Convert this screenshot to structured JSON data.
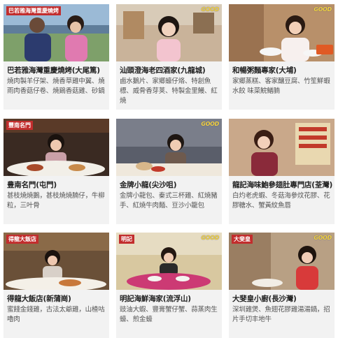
{
  "badge": {
    "brand": "GOOD"
  },
  "cards": [
    {
      "title": "巴若雅海灣重慶燒烤(大尾篤)",
      "desc": "燒肉製羊仔架、燒香草雞中翼、燒雨肉香菇仔卷、燒鷄香菇雞、砂鍋",
      "logo": "巴若雅海灣重慶燒烤"
    },
    {
      "title": "汕頭澄海老四酒家(九龍城)",
      "desc": "鹵水鵝片、家鄉蠔仔烙、特創魚標、威骨香芽荚、特製金里鰻、紅燒",
      "logo": ""
    },
    {
      "title": "和暢粥麵專家(大埔)",
      "desc": "家鄉蒸糕、客家釀豆腐、竹笙鮮蝦水餃 味菜鯇鱔腩",
      "logo": ""
    },
    {
      "title": "豊南名門(屯門)",
      "desc": "甚枝燒燒鵝，甚枝燒燒腩仔，牛柳粒，三叶骨",
      "logo": "豐南名門"
    },
    {
      "title": "金牌小龍(尖沙咀)",
      "desc": "金牌小龍包、秦式三杯雞、紅燒豬手、紅燒牛肉麵、豆沙小籠包",
      "logo": ""
    },
    {
      "title": "龍記海味鮑參翅肚專門店(荃灣)",
      "desc": "白灼老虎蝦、冬菇海參炆花膠、花膠糖水、蟹黃紋魚唇",
      "logo": ""
    },
    {
      "title": "得龍大飯店(新蒲崗)",
      "desc": "蜜餞金錢雞，古法太爺雞，山楂咕嚕肉",
      "logo": "得龍大飯店"
    },
    {
      "title": "明記海鮮海家(流浮山)",
      "desc": "豉油大蝦、豐膏蟹仔蟹、蒜蒸肉生蠔、煎金蠔",
      "logo": "明記"
    },
    {
      "title": "大斐皇小廚(長沙灣)",
      "desc": "深圳雞煲、魚翅花膠雞湯湯鍋，招片手切丰地牛",
      "logo": "大斐皇"
    }
  ],
  "colors": {
    "card_bg": "#f2f2f2",
    "title": "#222222",
    "desc": "#555555"
  }
}
